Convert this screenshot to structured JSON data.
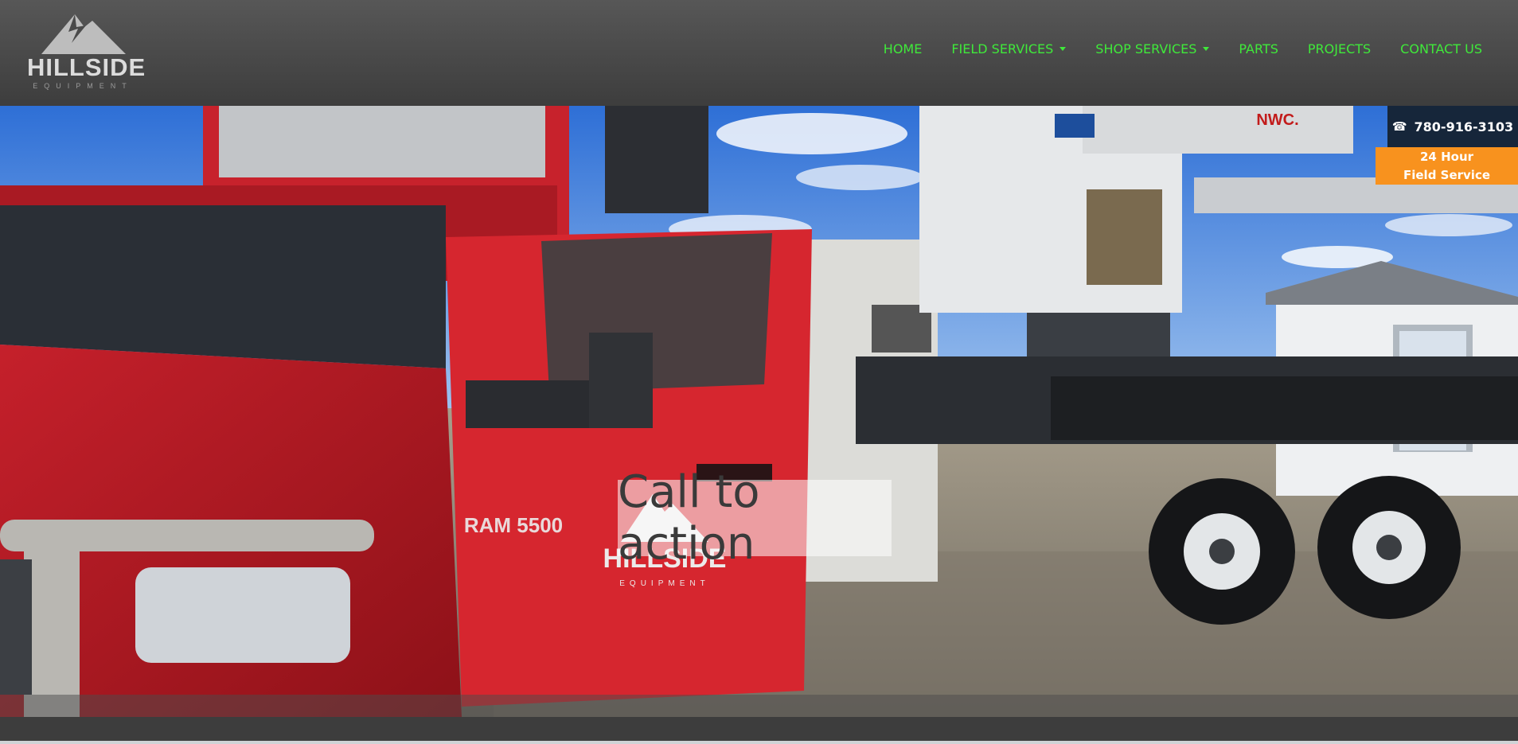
{
  "brand": {
    "name": "HILLSIDE",
    "tagline": "EQUIPMENT"
  },
  "nav": {
    "items": [
      {
        "label": "HOME",
        "dropdown": false
      },
      {
        "label": "FIELD SERVICES",
        "dropdown": true
      },
      {
        "label": "SHOP SERVICES",
        "dropdown": true
      },
      {
        "label": "PARTS",
        "dropdown": false
      },
      {
        "label": "PROJECTS",
        "dropdown": false
      },
      {
        "label": "CONTACT US",
        "dropdown": false
      }
    ]
  },
  "hero": {
    "cta_text": "Call to action",
    "truck_door_brand": "HILLSIDE",
    "truck_door_tagline": "EQUIPMENT",
    "truck_badge": "RAM 5500",
    "crane_brand": "NWC."
  },
  "contact": {
    "phone": "780-916-3103",
    "service_line1": "24 Hour",
    "service_line2": "Field Service"
  },
  "colors": {
    "nav_text": "#3fe93a",
    "header_bg": "#4a4a4a",
    "phone_bg": "#16263a",
    "service_bg": "#f8921e"
  },
  "icons": {
    "phone": "phone-icon",
    "logo": "mountain-logo-icon"
  }
}
